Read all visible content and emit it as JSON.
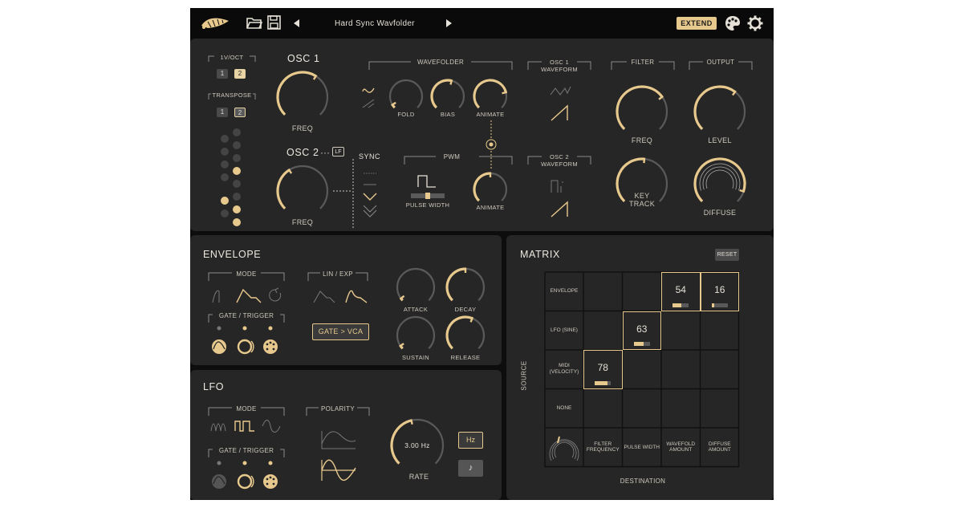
{
  "header": {
    "preset_name": "Hard Sync Wavfolder",
    "extend_label": "EXTEND"
  },
  "osc": {
    "tuning_label": "1V/OCT",
    "transpose_label": "TRANSPOSE",
    "btn1": "1",
    "btn2": "2",
    "osc1_title": "OSC 1",
    "osc1_freq_label": "FREQ",
    "osc2_title": "OSC 2",
    "osc2_dots": "···",
    "lf_badge": "LF",
    "osc2_freq_label": "FREQ",
    "sync_label": "SYNC",
    "wavefolder_label": "WAVEFOLDER",
    "fold_label": "FOLD",
    "bias_label": "BIAS",
    "animate_label": "ANIMATE",
    "pwm_label": "PWM",
    "pulse_width_label": "PULSE WIDTH",
    "pwm_animate_label": "ANIMATE",
    "osc1_waveform_label1": "OSC 1",
    "osc1_waveform_label2": "WAVEFORM",
    "osc2_waveform_label1": "OSC 2",
    "osc2_waveform_label2": "WAVEFORM",
    "filter_label": "FILTER",
    "filter_freq_label": "FREQ",
    "key_label": "KEY",
    "track_label": "TRACK",
    "output_label": "OUTPUT",
    "level_label": "LEVEL",
    "diffuse_label": "DIFFUSE"
  },
  "knobs": {
    "osc1_freq": 0.62,
    "osc2_freq": 0.38,
    "fold": 0.05,
    "bias": 0.55,
    "wf_animate": 0.78,
    "pwm_animate": 0.5,
    "filter_freq": 0.7,
    "key_track": 0.52,
    "level": 0.64,
    "diffuse": 0.9,
    "attack": 0.03,
    "decay": 0.5,
    "sustain": 0.04,
    "release": 0.58,
    "rate": 0.45
  },
  "envelope": {
    "title": "ENVELOPE",
    "mode_label": "MODE",
    "lin_exp_label": "LIN / EXP",
    "gate_trigger_label": "GATE / TRIGGER",
    "gate_vca_label": "GATE > VCA",
    "attack_label": "ATTACK",
    "decay_label": "DECAY",
    "sustain_label": "SUSTAIN",
    "release_label": "RELEASE"
  },
  "lfo": {
    "title": "LFO",
    "mode_label": "MODE",
    "polarity_label": "POLARITY",
    "gate_trigger_label": "GATE / TRIGGER",
    "rate_value": "3.00 Hz",
    "rate_label": "RATE",
    "hz_label": "Hz",
    "note_label": "♪"
  },
  "matrix": {
    "title": "MATRIX",
    "reset_label": "RESET",
    "source_axis": "SOURCE",
    "destination_axis": "DESTINATION",
    "sources": [
      {
        "label1": "ENVELOPE",
        "label2": ""
      },
      {
        "label1": "LFO (SINE)",
        "label2": ""
      },
      {
        "label1": "MIDI",
        "label2": "(VELOCITY)"
      },
      {
        "label1": "NONE",
        "label2": ""
      }
    ],
    "destinations": [
      {
        "label1": "FILTER",
        "label2": "FREQUENCY"
      },
      {
        "label1": "PULSE WIDTH",
        "label2": ""
      },
      {
        "label1": "WAVEFOLD",
        "label2": "AMOUNT"
      },
      {
        "label1": "DIFFUSE",
        "label2": "AMOUNT"
      }
    ],
    "cells": [
      {
        "row": 0,
        "col": 2,
        "value": "54",
        "bar": 0.54
      },
      {
        "row": 0,
        "col": 3,
        "value": "16",
        "bar": 0.16
      },
      {
        "row": 1,
        "col": 1,
        "value": "63",
        "bar": 0.63
      },
      {
        "row": 2,
        "col": 0,
        "value": "78",
        "bar": 0.78
      }
    ]
  },
  "colors": {
    "accent": "#e8c98d",
    "panel": "#262626",
    "background": "#0d0d0d",
    "track": "#5a5a5a"
  }
}
